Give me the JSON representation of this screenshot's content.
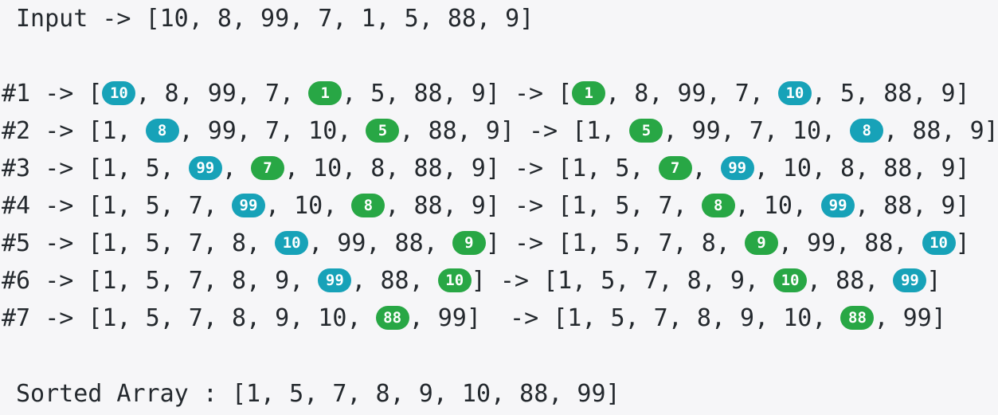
{
  "input": {
    "label": "Input",
    "arrow": "->",
    "array": "[10, 8, 99, 7, 1, 5, 88, 9]"
  },
  "colors": {
    "blue_badge": "#17a2b8",
    "green_badge": "#28a745",
    "background": "#f6f6f8",
    "text": "#24292e"
  },
  "steps": [
    {
      "label": "#1",
      "before": [
        {
          "t": "[",
          "b": null
        },
        {
          "t": "10",
          "b": "blue"
        },
        {
          "t": ", 8, 99, 7, ",
          "b": null
        },
        {
          "t": "1",
          "b": "green"
        },
        {
          "t": ", 5, 88, 9]",
          "b": null
        }
      ],
      "after": [
        {
          "t": "[",
          "b": null
        },
        {
          "t": "1",
          "b": "green"
        },
        {
          "t": ", 8, 99, 7, ",
          "b": null
        },
        {
          "t": "10",
          "b": "blue"
        },
        {
          "t": ", 5, 88, 9]",
          "b": null
        }
      ]
    },
    {
      "label": "#2",
      "before": [
        {
          "t": "[1, ",
          "b": null
        },
        {
          "t": "8",
          "b": "blue"
        },
        {
          "t": ", 99, 7, 10, ",
          "b": null
        },
        {
          "t": "5",
          "b": "green"
        },
        {
          "t": ", 88, 9]",
          "b": null
        }
      ],
      "after": [
        {
          "t": "[1, ",
          "b": null
        },
        {
          "t": "5",
          "b": "green"
        },
        {
          "t": ", 99, 7, 10, ",
          "b": null
        },
        {
          "t": "8",
          "b": "blue"
        },
        {
          "t": ", 88, 9]",
          "b": null
        }
      ]
    },
    {
      "label": "#3",
      "before": [
        {
          "t": "[1, 5, ",
          "b": null
        },
        {
          "t": "99",
          "b": "blue"
        },
        {
          "t": ", ",
          "b": null
        },
        {
          "t": "7",
          "b": "green"
        },
        {
          "t": ", 10, 8, 88, 9]",
          "b": null
        }
      ],
      "after": [
        {
          "t": "[1, 5, ",
          "b": null
        },
        {
          "t": "7",
          "b": "green"
        },
        {
          "t": ", ",
          "b": null
        },
        {
          "t": "99",
          "b": "blue"
        },
        {
          "t": ", 10, 8, 88, 9]",
          "b": null
        }
      ]
    },
    {
      "label": "#4",
      "before": [
        {
          "t": "[1, 5, 7, ",
          "b": null
        },
        {
          "t": "99",
          "b": "blue"
        },
        {
          "t": ", 10, ",
          "b": null
        },
        {
          "t": "8",
          "b": "green"
        },
        {
          "t": ", 88, 9]",
          "b": null
        }
      ],
      "after": [
        {
          "t": "[1, 5, 7, ",
          "b": null
        },
        {
          "t": "8",
          "b": "green"
        },
        {
          "t": ", 10, ",
          "b": null
        },
        {
          "t": "99",
          "b": "blue"
        },
        {
          "t": ", 88, 9]",
          "b": null
        }
      ]
    },
    {
      "label": "#5",
      "before": [
        {
          "t": "[1, 5, 7, 8, ",
          "b": null
        },
        {
          "t": "10",
          "b": "blue"
        },
        {
          "t": ", 99, 88, ",
          "b": null
        },
        {
          "t": "9",
          "b": "green"
        },
        {
          "t": "]",
          "b": null
        }
      ],
      "after": [
        {
          "t": "[1, 5, 7, 8, ",
          "b": null
        },
        {
          "t": "9",
          "b": "green"
        },
        {
          "t": ", 99, 88, ",
          "b": null
        },
        {
          "t": "10",
          "b": "blue"
        },
        {
          "t": "]",
          "b": null
        }
      ]
    },
    {
      "label": "#6",
      "before": [
        {
          "t": "[1, 5, 7, 8, 9, ",
          "b": null
        },
        {
          "t": "99",
          "b": "blue"
        },
        {
          "t": ", 88, ",
          "b": null
        },
        {
          "t": "10",
          "b": "green"
        },
        {
          "t": "]",
          "b": null
        }
      ],
      "after": [
        {
          "t": "[1, 5, 7, 8, 9, ",
          "b": null
        },
        {
          "t": "10",
          "b": "green"
        },
        {
          "t": ", 88, ",
          "b": null
        },
        {
          "t": "99",
          "b": "blue"
        },
        {
          "t": "]",
          "b": null
        }
      ]
    },
    {
      "label": "#7",
      "before": [
        {
          "t": "[1, 5, 7, 8, 9, 10, ",
          "b": null
        },
        {
          "t": "88",
          "b": "green"
        },
        {
          "t": ", 99]",
          "b": null
        }
      ],
      "after": [
        {
          "t": "[1, 5, 7, 8, 9, 10, ",
          "b": null
        },
        {
          "t": "88",
          "b": "green"
        },
        {
          "t": ", 99]",
          "b": null
        }
      ]
    }
  ],
  "arrow": "->",
  "sorted": {
    "label": "Sorted Array",
    "separator": ":",
    "array": "[1, 5, 7, 8, 9, 10, 88, 99]"
  }
}
